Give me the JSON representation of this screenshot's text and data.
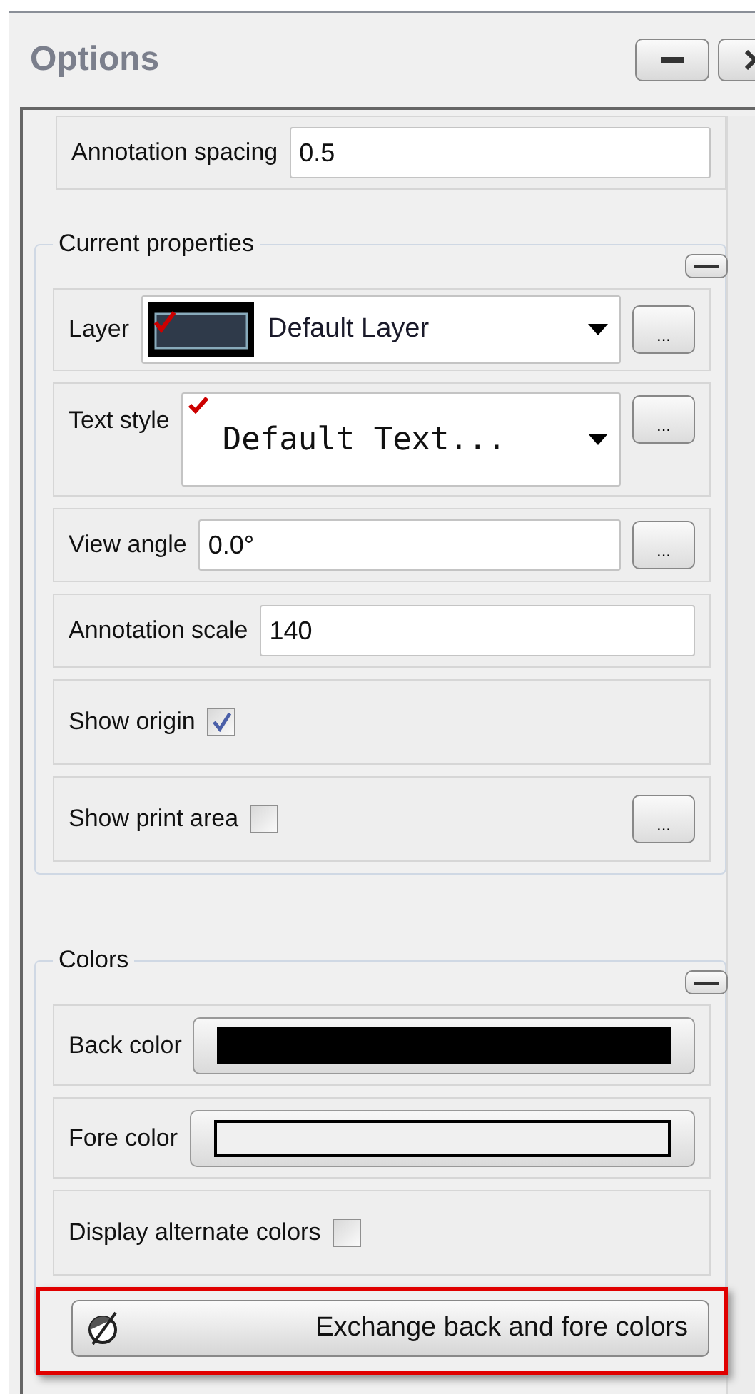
{
  "panel": {
    "title": "Options"
  },
  "top_row": {
    "label": "Annotation spacing",
    "value": "0.5"
  },
  "groups": [
    {
      "title": "Current properties",
      "rows": [
        {
          "kind": "layer",
          "label": "Layer",
          "value": "Default Layer",
          "more": "..."
        },
        {
          "kind": "textstyle",
          "label": "Text style",
          "value": "Default Text...",
          "more": "..."
        },
        {
          "kind": "field",
          "label": "View angle",
          "value": "0.0°",
          "more": "..."
        },
        {
          "kind": "field",
          "label": "Annotation scale",
          "value": "140"
        },
        {
          "kind": "check",
          "label": "Show origin",
          "checked": true
        },
        {
          "kind": "check",
          "label": "Show print area",
          "checked": false,
          "more": "..."
        }
      ]
    },
    {
      "title": "Colors",
      "rows": [
        {
          "kind": "color",
          "label": "Back color",
          "color": "#000000"
        },
        {
          "kind": "color",
          "label": "Fore color",
          "color": "#f0f0f0"
        },
        {
          "kind": "check",
          "label": "Display alternate colors",
          "checked": false
        },
        {
          "kind": "action",
          "label": "Exchange back and fore colors",
          "highlighted": true
        }
      ]
    }
  ]
}
